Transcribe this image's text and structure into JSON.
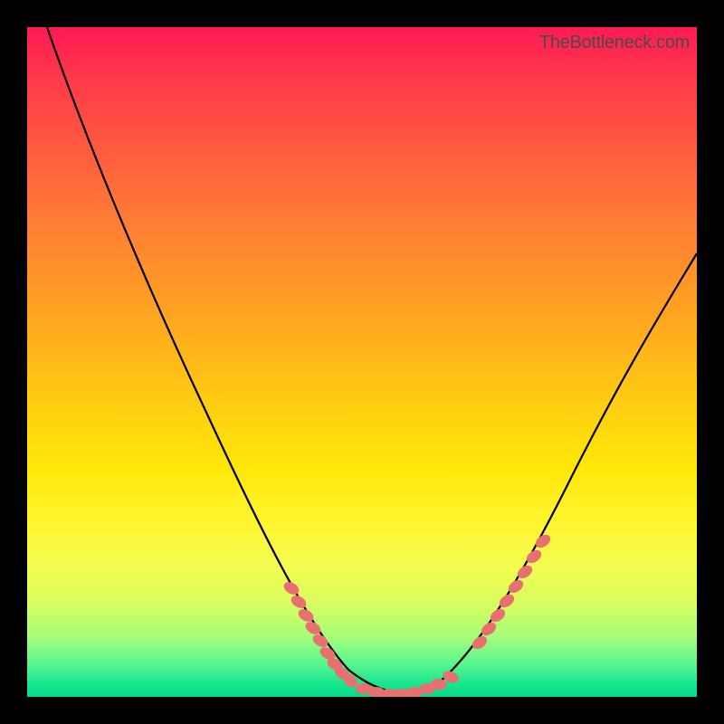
{
  "watermark": "TheBottleneck.com",
  "chart_data": {
    "type": "line",
    "title": "",
    "xlabel": "",
    "ylabel": "",
    "xlim": [
      0,
      100
    ],
    "ylim": [
      0,
      100
    ],
    "series": [
      {
        "name": "bottleneck_curve",
        "x": [
          3,
          6,
          10,
          14,
          18,
          22,
          26,
          30,
          34,
          38,
          42,
          45,
          48,
          51,
          54,
          57,
          60,
          63,
          66,
          69,
          72,
          76,
          80,
          84,
          88,
          92,
          96,
          100
        ],
        "y": [
          100,
          94,
          86,
          78,
          70,
          62,
          54,
          46,
          38,
          30,
          22,
          16,
          10,
          5,
          2,
          1,
          1,
          2,
          5,
          9,
          14,
          20,
          27,
          34,
          41,
          48,
          55,
          62
        ]
      }
    ],
    "markers": {
      "left_cluster": {
        "x_range": [
          38,
          48
        ],
        "count": 9
      },
      "bottom_cluster": {
        "x_range": [
          50,
          62
        ],
        "count": 8
      },
      "right_cluster": {
        "x_range": [
          66,
          75
        ],
        "count": 8
      }
    },
    "colors": {
      "gradient_top": "#ff1a54",
      "gradient_bottom": "#07d889",
      "curve": "#000000",
      "marker_fill": "#e97070",
      "frame": "#000000"
    }
  }
}
